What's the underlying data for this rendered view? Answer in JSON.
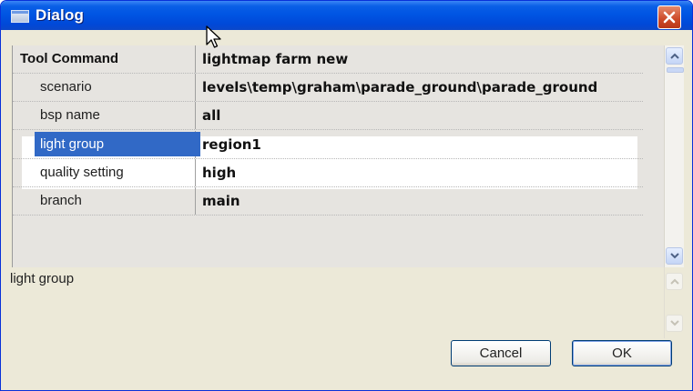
{
  "window": {
    "title": "Dialog"
  },
  "grid": {
    "header": {
      "name": "Tool Command",
      "value": "lightmap farm new"
    },
    "rows": [
      {
        "name": "scenario",
        "value": "levels\\temp\\graham\\parade_ground\\parade_ground"
      },
      {
        "name": "bsp name",
        "value": "all"
      },
      {
        "name": "light group",
        "value": "region1",
        "selected": true
      },
      {
        "name": "quality setting",
        "value": "high"
      },
      {
        "name": "branch",
        "value": "main"
      }
    ]
  },
  "description": {
    "text": "light group"
  },
  "buttons": {
    "cancel": "Cancel",
    "ok": "OK"
  },
  "colors": {
    "title_bar": "#0055e3",
    "selection": "#3169c6",
    "close_button": "#cd4928",
    "dialog_background": "#ece9d8"
  },
  "icons": {
    "title": "window-icon",
    "close": "close-icon",
    "cursor": "mouse-pointer-icon",
    "scroll_up": "chevron-up-icon",
    "scroll_down": "chevron-down-icon"
  }
}
